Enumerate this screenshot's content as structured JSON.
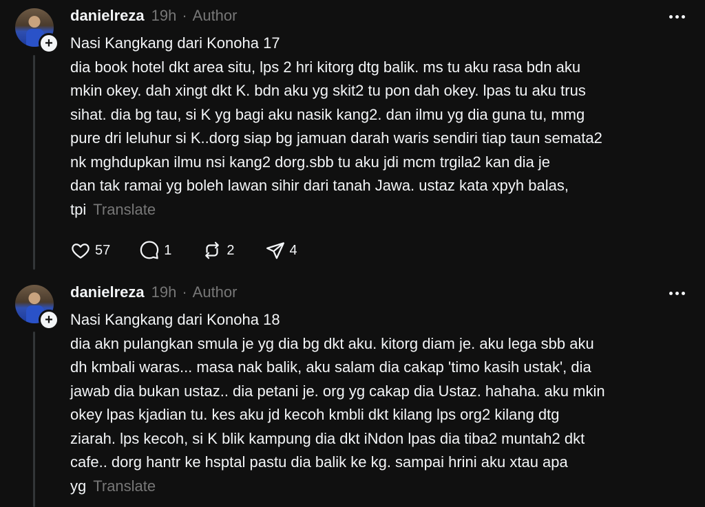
{
  "posts": [
    {
      "username": "danielreza",
      "time": "19h",
      "author_label": "Author",
      "title": "Nasi Kangkang dari Konoha 17",
      "lines": [
        "dia book hotel dkt area situ, lps 2 hri kitorg dtg balik. ms tu aku rasa bdn aku",
        "mkin okey. dah xingt dkt K. bdn aku yg skit2 tu pon dah okey. lpas tu aku trus",
        "sihat. dia bg tau, si K yg bagi aku nasik kang2. dan ilmu yg dia guna tu, mmg",
        "pure dri leluhur si K..dorg siap bg jamuan darah waris sendiri tiap taun semata2",
        "nk mghdupkan ilmu nsi kang2 dorg.sbb tu aku jdi mcm trgila2 kan dia je",
        "dan tak ramai yg boleh lawan sihir dari tanah Jawa. ustaz kata xpyh balas,"
      ],
      "last_line": "tpi",
      "translate": "Translate",
      "likes": "57",
      "comments": "1",
      "reposts": "2",
      "shares": "4"
    },
    {
      "username": "danielreza",
      "time": "19h",
      "author_label": "Author",
      "title": "Nasi Kangkang dari Konoha 18",
      "lines": [
        "dia akn pulangkan smula je yg dia bg dkt aku. kitorg diam je. aku lega sbb aku",
        "dh kmbali waras... masa nak balik, aku salam dia cakap 'timo kasih ustak', dia",
        "jawab dia bukan ustaz.. dia petani je. org yg cakap dia Ustaz. hahaha. aku mkin",
        "okey lpas kjadian tu. kes aku jd kecoh kmbli dkt kilang lps org2 kilang dtg",
        "ziarah. lps kecoh, si K blik kampung dia dkt iNdon lpas dia tiba2 muntah2 dkt",
        "cafe.. dorg hantr ke hsptal pastu dia balik ke kg. sampai hrini aku xtau apa"
      ],
      "last_line": "yg",
      "translate": "Translate"
    }
  ]
}
